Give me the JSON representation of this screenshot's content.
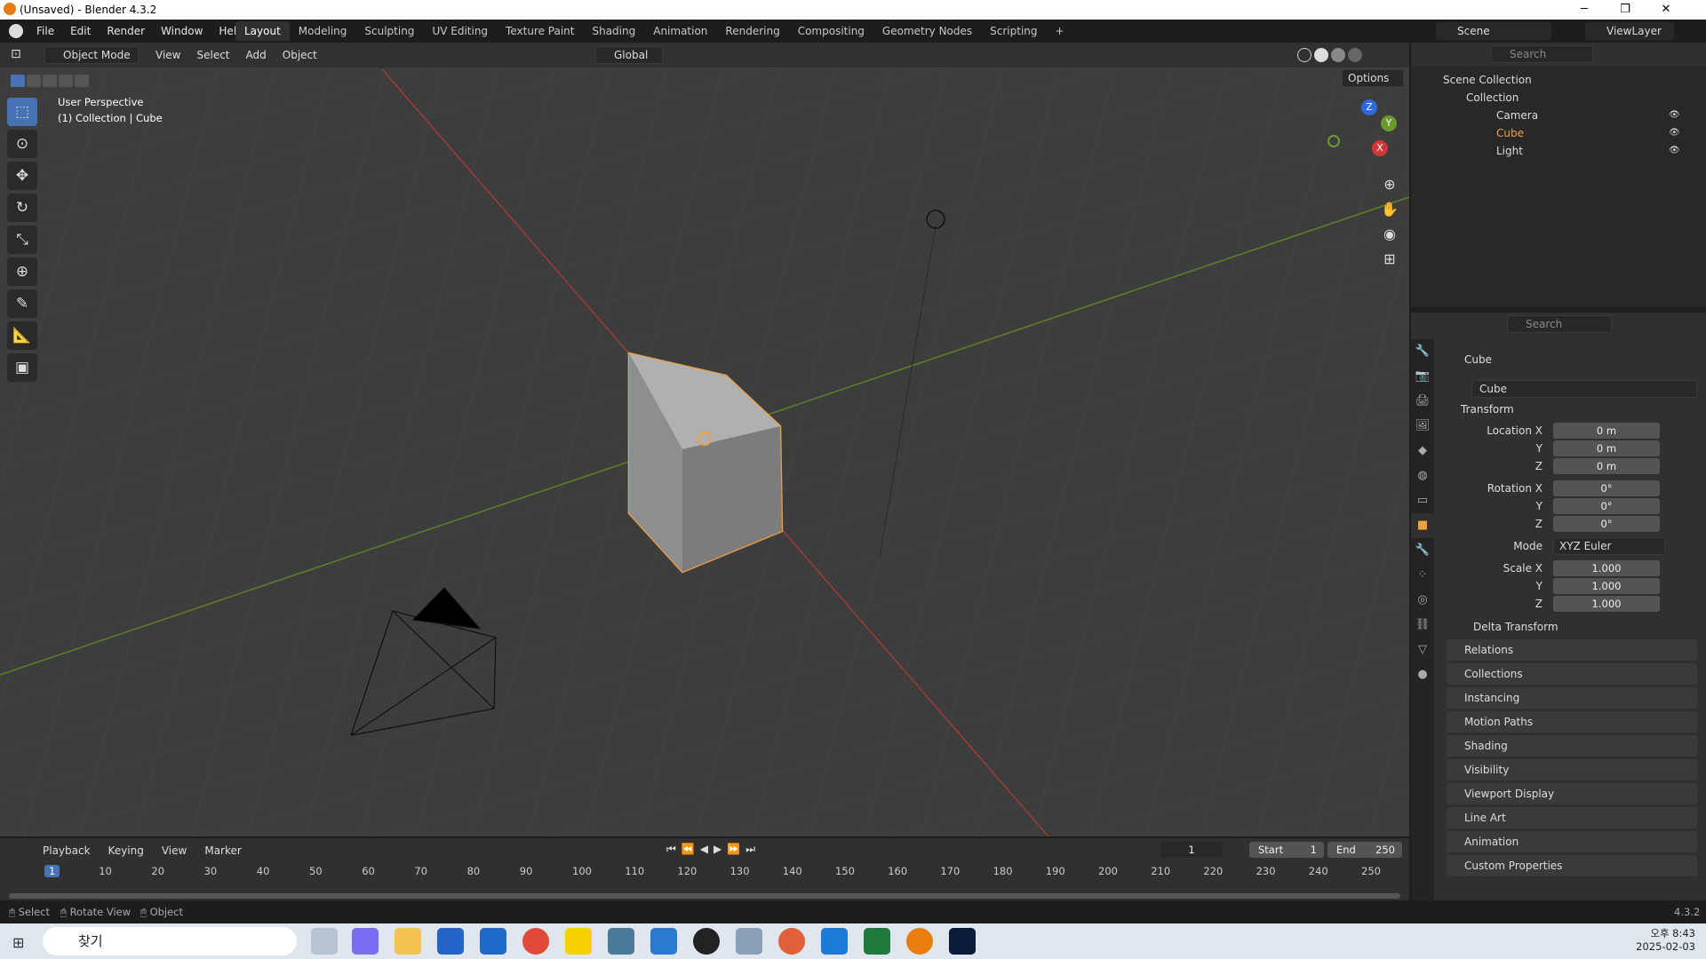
{
  "window": {
    "title": "(Unsaved) - Blender 4.3.2",
    "minimize": "─",
    "restore": "❐",
    "close": "✕"
  },
  "menu": [
    "File",
    "Edit",
    "Render",
    "Window",
    "Help"
  ],
  "workspaces": [
    "Layout",
    "Modeling",
    "Sculpting",
    "UV Editing",
    "Texture Paint",
    "Shading",
    "Animation",
    "Rendering",
    "Compositing",
    "Geometry Nodes",
    "Scripting",
    "+"
  ],
  "scene": {
    "name": "Scene",
    "viewlayer": "ViewLayer"
  },
  "viewport_header": {
    "mode": "Object Mode",
    "menus": [
      "View",
      "Select",
      "Add",
      "Object"
    ],
    "orientation": "Global",
    "options": "Options"
  },
  "overlay_text": {
    "view": "User Perspective",
    "collection": "(1) Collection | Cube"
  },
  "gizmo": {
    "z": "Z",
    "y": "Y",
    "x": "X"
  },
  "outliner": {
    "search": "Search",
    "root": "Scene Collection",
    "collection": "Collection",
    "items": [
      {
        "name": "Camera",
        "color": "#dddddd"
      },
      {
        "name": "Cube",
        "color": "#f0a040"
      },
      {
        "name": "Light",
        "color": "#dddddd"
      }
    ]
  },
  "properties": {
    "search": "Search",
    "object_name": "Cube",
    "data_name": "Cube",
    "transform": "Transform",
    "location": {
      "label": "Location X",
      "x": "0 m",
      "y": "0 m",
      "z": "0 m"
    },
    "rotation": {
      "label": "Rotation X",
      "x": "0°",
      "y": "0°",
      "z": "0°"
    },
    "mode_label": "Mode",
    "mode": "XYZ Euler",
    "scale": {
      "label": "Scale X",
      "x": "1.000",
      "y": "1.000",
      "z": "1.000"
    },
    "axis_y": "Y",
    "axis_z": "Z",
    "delta": "Delta Transform",
    "panels": [
      "Relations",
      "Collections",
      "Instancing",
      "Motion Paths",
      "Shading",
      "Visibility",
      "Viewport Display",
      "Line Art",
      "Animation",
      "Custom Properties"
    ]
  },
  "timeline": {
    "menus": [
      "Playback",
      "Keying",
      "View",
      "Marker"
    ],
    "current": "1",
    "start_label": "Start",
    "start": "1",
    "end_label": "End",
    "end": "250",
    "ticks": [
      "1",
      "10",
      "20",
      "30",
      "40",
      "50",
      "60",
      "70",
      "80",
      "90",
      "100",
      "110",
      "120",
      "130",
      "140",
      "150",
      "160",
      "170",
      "180",
      "190",
      "200",
      "210",
      "220",
      "230",
      "240",
      "250"
    ]
  },
  "status": {
    "select": "Select",
    "rotate": "Rotate View",
    "object": "Object",
    "version": "4.3.2"
  },
  "taskbar": {
    "search": "찾기",
    "time": "오후 8:43",
    "date": "2025-02-03"
  },
  "colors": {
    "accent": "#4772b3",
    "selection": "#f0a040",
    "x_axis": "#c84040",
    "y_axis": "#6a9a2a"
  }
}
